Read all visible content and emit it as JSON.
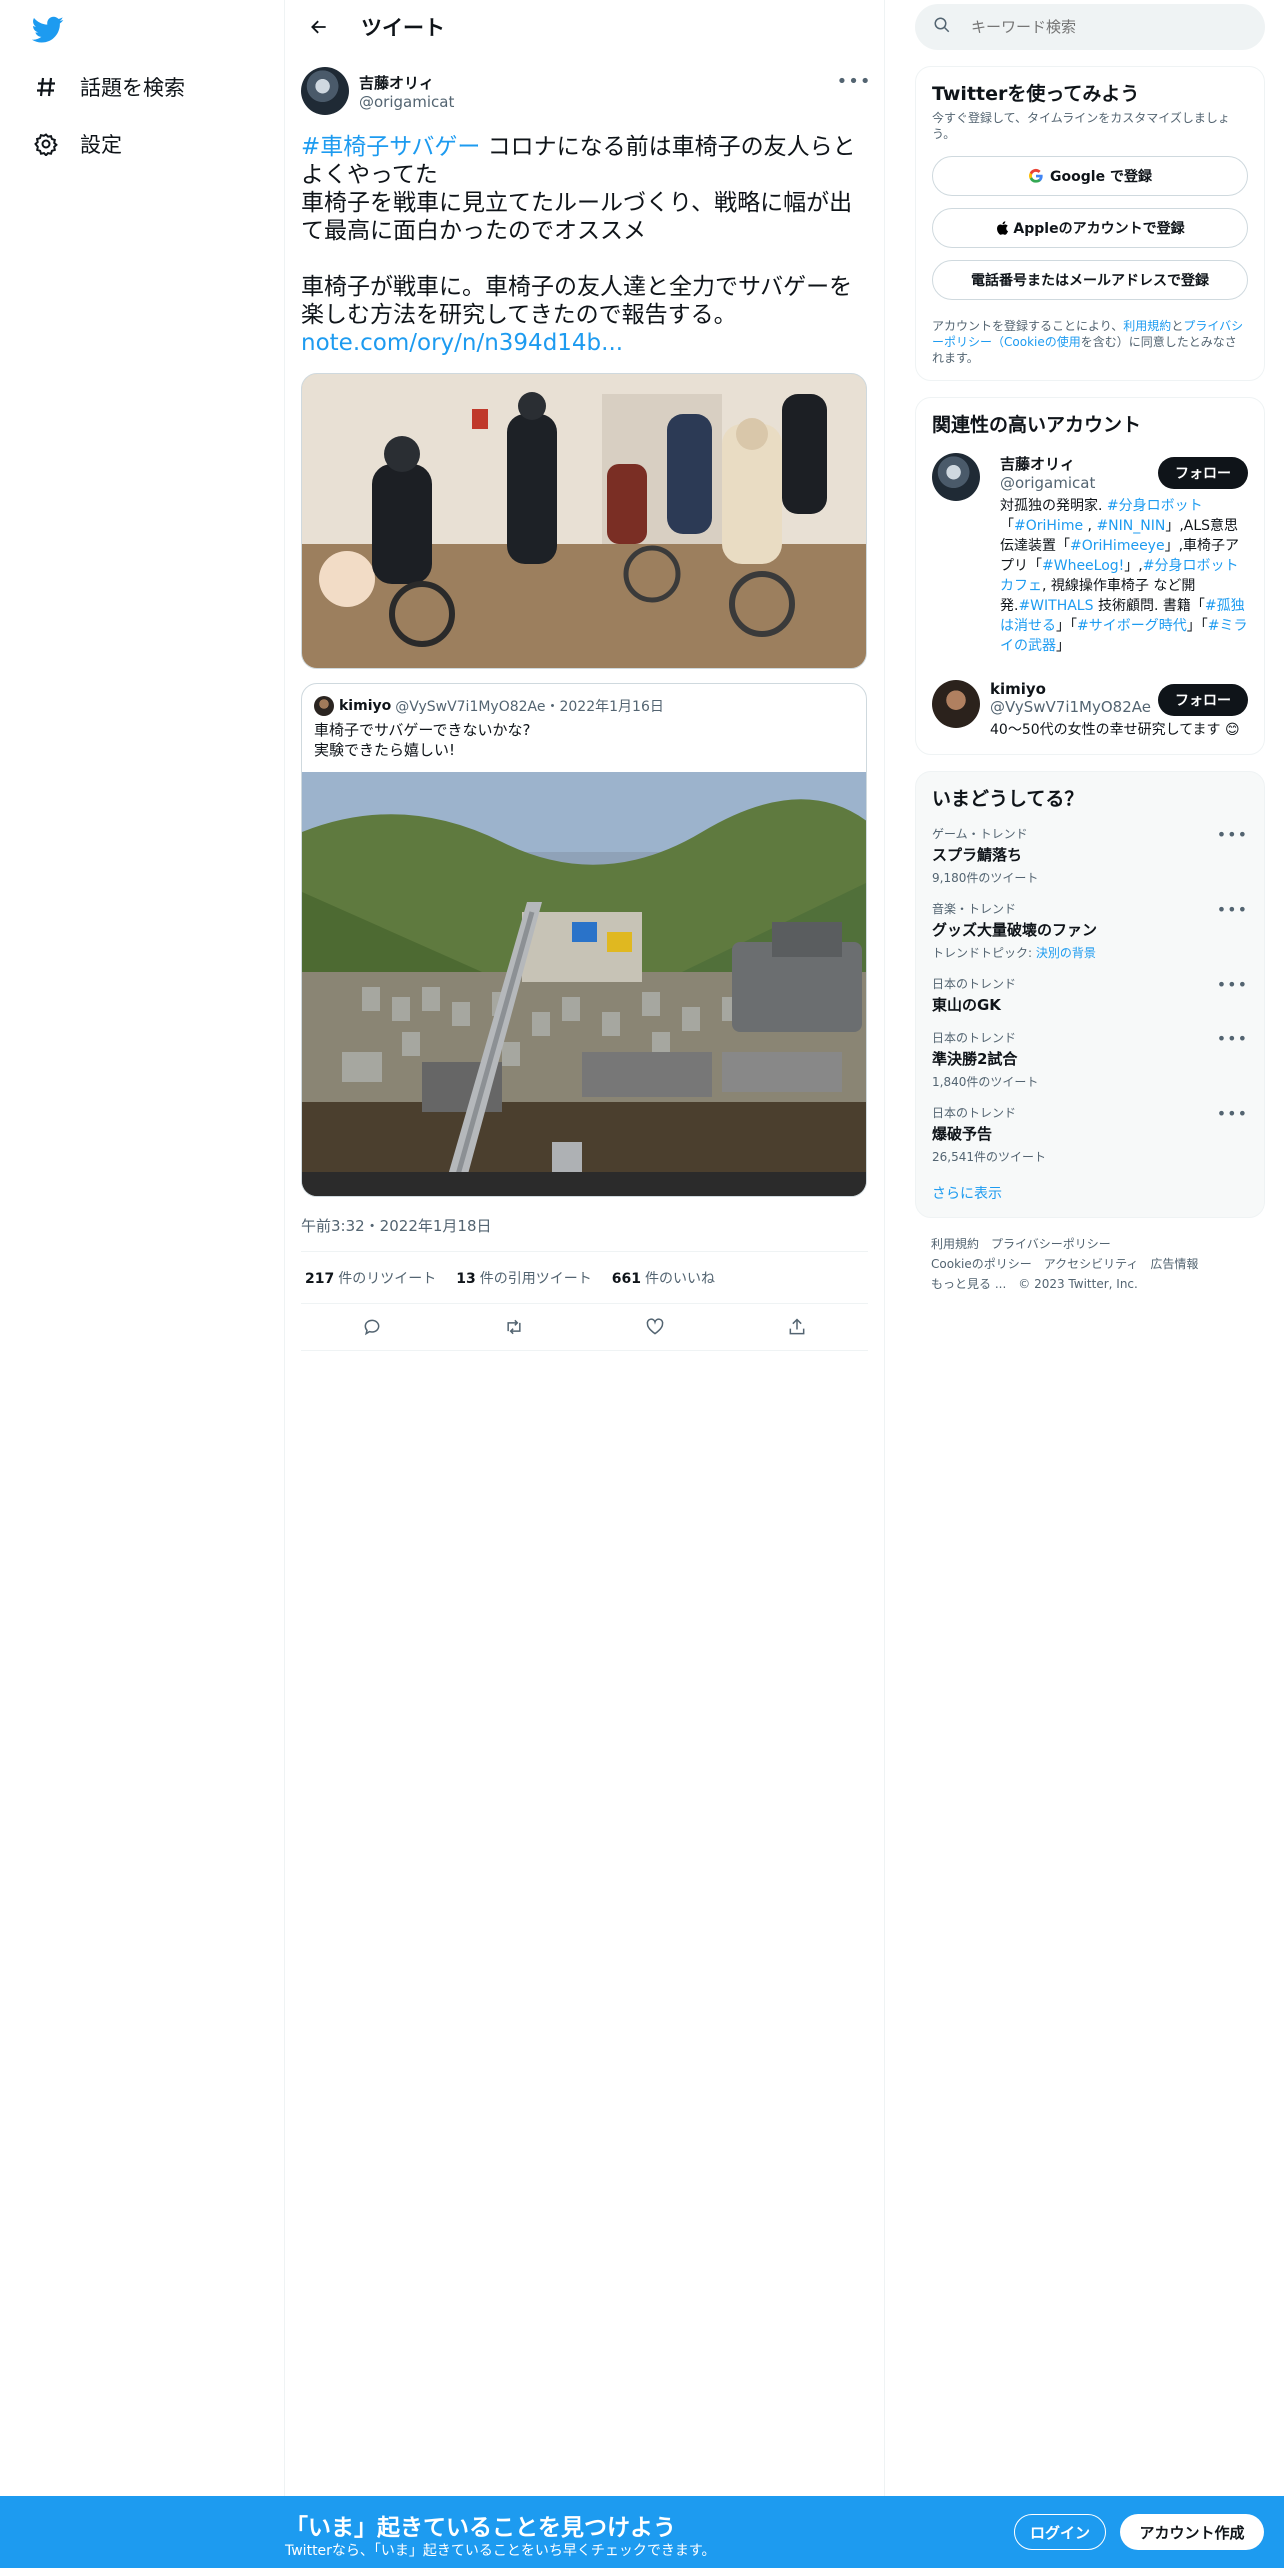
{
  "nav": {
    "explore": "話題を検索",
    "settings": "設定"
  },
  "header": {
    "title": "ツイート"
  },
  "tweet": {
    "author_name": "吉藤オリィ",
    "author_handle": "@origamicat",
    "hashtag": "#車椅子サバゲー",
    "line1": " コロナになる前は車椅子の友人らとよくやってた",
    "line2": "車椅子を戦車に見立てたルールづくり、戦略に幅が出て最高に面白かったのでオススメ",
    "line3": "車椅子が戦車に。車椅子の友人達と全力でサバゲーを楽しむ方法を研究してきたので報告する。",
    "link": "note.com/ory/n/n394d14b...",
    "timestamp": "午前3:32・2022年1月18日",
    "retweets_count": "217",
    "retweets_label": "件のリツイート",
    "quotes_count": "13",
    "quotes_label": "件の引用ツイート",
    "likes_count": "661",
    "likes_label": "件のいいね"
  },
  "quote": {
    "name": "kimiyo",
    "meta": "@VySwV7i1MyO82Ae・2022年1月16日",
    "line1": "車椅子でサバゲーできないかな?",
    "line2": "実験できたら嬉しい!"
  },
  "right": {
    "search_placeholder": "キーワード検索",
    "signup_title": "Twitterを使ってみよう",
    "signup_sub": "今すぐ登録して、タイムラインをカスタマイズしましょう。",
    "google_btn": "Google で登録",
    "apple_btn": "Appleのアカウントで登録",
    "phone_btn": "電話番号またはメールアドレスで登録",
    "terms_pre": "アカウントを登録することにより、",
    "terms_link1": "利用規約",
    "terms_mid1": "と",
    "terms_link2": "プライバシーポリシー（Cookieの使用",
    "terms_post": "を含む）に同意したとみなされます。",
    "related_title": "関連性の高いアカウント",
    "acct1_name": "吉藤オリィ",
    "acct1_handle": "@origamicat",
    "acct1_bio_1": "対孤独の発明家.",
    "acct1_bio_tag1": " #分身ロボット",
    "acct1_bio_2": "「",
    "acct1_bio_tag2": "#OriHime",
    "acct1_bio_3": " , ",
    "acct1_bio_tag3": "#NIN_NIN",
    "acct1_bio_4": "」,ALS意思伝達装置「",
    "acct1_bio_tag4": "#OriHimeeye",
    "acct1_bio_5": "」,車椅子アプリ「",
    "acct1_bio_tag5": "#WheeLog!",
    "acct1_bio_6": "」,",
    "acct1_bio_tag6": "#分身ロボットカフェ",
    "acct1_bio_7": ", 視線操作車椅子 など開発.",
    "acct1_bio_tag7": "#WITHALS",
    "acct1_bio_8": " 技術顧問. 書籍「",
    "acct1_bio_tag8": "#孤独は消せる",
    "acct1_bio_9": "」「",
    "acct1_bio_tag9": "#サイボーグ時代",
    "acct1_bio_10": "」「",
    "acct1_bio_tag10": "#ミライの武器",
    "acct1_bio_11": "」",
    "acct2_name": "kimiyo",
    "acct2_handle": "@VySwV7i1MyO82Ae",
    "acct2_bio": "40〜50代の女性の幸せ研究してます",
    "follow_label": "フォロー",
    "trends_title": "いまどうしてる？",
    "trends": [
      {
        "category": "ゲーム・トレンド",
        "name": "スプラ鯖落ち",
        "count": "9,180件のツイート"
      },
      {
        "category": "音楽・トレンド",
        "name": "グッズ大量破壊のファン",
        "count_prefix": "トレンドトピック: ",
        "count_link": "決別の背景"
      },
      {
        "category": "日本のトレンド",
        "name": "東山のGK"
      },
      {
        "category": "日本のトレンド",
        "name": "準決勝2試合",
        "count": "1,840件のツイート"
      },
      {
        "category": "日本のトレンド",
        "name": "爆破予告",
        "count": "26,541件のツイート"
      }
    ],
    "show_more": "さらに表示",
    "footer": {
      "terms": "利用規約",
      "privacy": "プライバシーポリシー",
      "cookie": "Cookieのポリシー",
      "accessibility": "アクセシビリティ",
      "ads": "広告情報",
      "more": "もっと見る ...",
      "copyright": "© 2023 Twitter, Inc."
    }
  },
  "bottom_bar": {
    "title": "「いま」起きていることを見つけよう",
    "subtitle": "Twitterなら、「いま」起きていることをいち早くチェックできます。",
    "login": "ログイン",
    "signup": "アカウント作成"
  },
  "colors": {
    "accent": "#1d9bf0",
    "text": "#0f1419",
    "muted": "#536471"
  },
  "icons": [
    "twitter-bird-icon",
    "hashtag-icon",
    "gear-icon",
    "back-arrow-icon",
    "more-icon",
    "search-icon",
    "google-icon",
    "apple-icon",
    "reply-icon",
    "retweet-icon",
    "like-icon",
    "share-icon"
  ]
}
